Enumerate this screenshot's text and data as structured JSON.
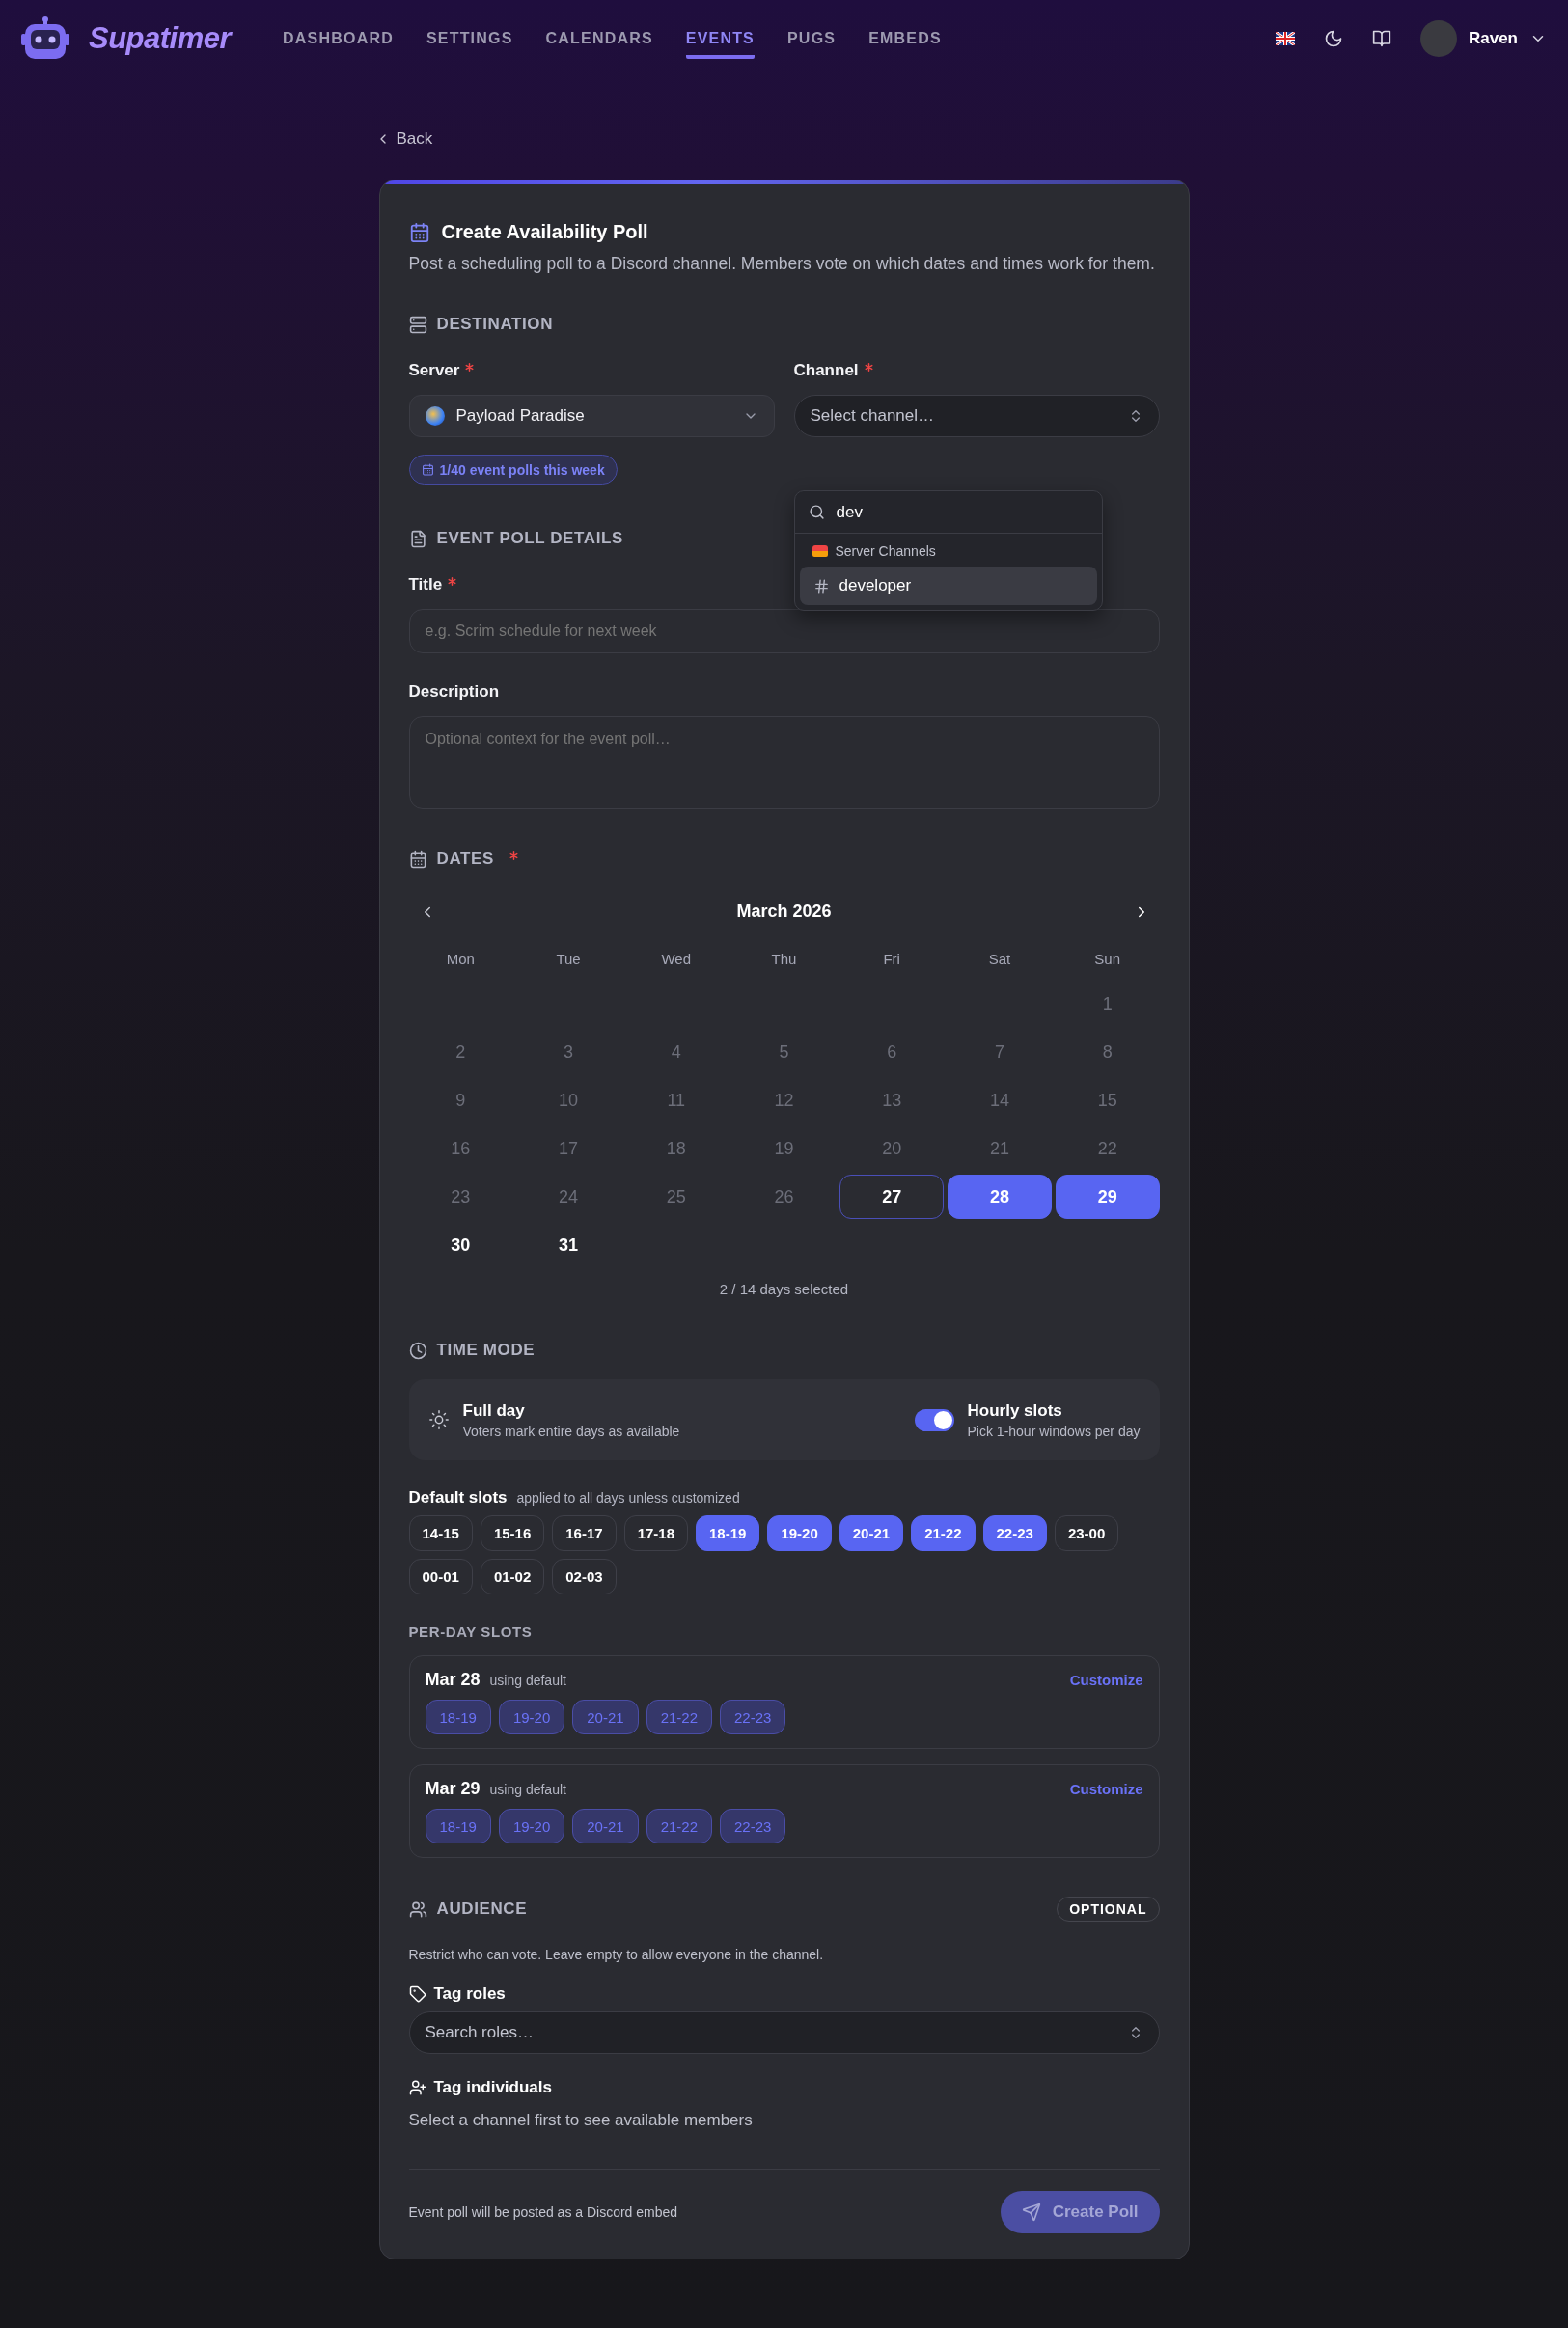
{
  "header": {
    "brand": "Supatimer",
    "nav": [
      {
        "label": "DASHBOARD",
        "selected": false
      },
      {
        "label": "SETTINGS",
        "selected": false
      },
      {
        "label": "CALENDARS",
        "selected": false
      },
      {
        "label": "EVENTS",
        "selected": true
      },
      {
        "label": "PUGS",
        "selected": false
      },
      {
        "label": "EMBEDS",
        "selected": false
      }
    ],
    "user": {
      "name": "Raven"
    }
  },
  "back": {
    "label": "Back"
  },
  "poll": {
    "title": "Create Availability Poll",
    "description": "Post a scheduling poll to a Discord channel. Members vote on which dates and times work for them.",
    "destination": {
      "heading": "DESTINATION",
      "server": {
        "label": "Server",
        "required": true,
        "value": "Payload Paradise"
      },
      "quota": "1/40 event polls this week",
      "channel": {
        "label": "Channel",
        "required": true,
        "placeholder": "Select channel…",
        "dropdown": {
          "query": "dev",
          "group": "Server Channels",
          "options": [
            {
              "label": "developer",
              "selected": true
            }
          ]
        }
      }
    },
    "details": {
      "heading": "EVENT POLL DETAILS",
      "title": {
        "label": "Title",
        "required": true,
        "placeholder": "e.g. Scrim schedule for next week"
      },
      "description": {
        "label": "Description",
        "required": false,
        "placeholder": "Optional context for the event poll…"
      }
    },
    "dates": {
      "heading": "DATES",
      "required": true,
      "month": "March 2026",
      "weekdays": [
        "Mon",
        "Tue",
        "Wed",
        "Thu",
        "Fri",
        "Sat",
        "Sun"
      ],
      "weeks": [
        {
          "days": [
            {
              "label": "1",
              "kind": "past",
              "selected": false
            }
          ]
        },
        {
          "days": [
            {
              "label": "2",
              "kind": "past",
              "selected": false
            },
            {
              "label": "3",
              "kind": "past",
              "selected": false
            },
            {
              "label": "4",
              "kind": "past",
              "selected": false
            },
            {
              "label": "5",
              "kind": "past",
              "selected": false
            },
            {
              "label": "6",
              "kind": "past",
              "selected": false
            },
            {
              "label": "7",
              "kind": "past",
              "selected": false
            },
            {
              "label": "8",
              "kind": "past",
              "selected": false
            }
          ]
        },
        {
          "days": [
            {
              "label": "9",
              "kind": "past",
              "selected": false
            },
            {
              "label": "10",
              "kind": "past",
              "selected": false
            },
            {
              "label": "11",
              "kind": "past",
              "selected": false
            },
            {
              "label": "12",
              "kind": "past",
              "selected": false
            },
            {
              "label": "13",
              "kind": "past",
              "selected": false
            },
            {
              "label": "14",
              "kind": "past",
              "selected": false
            },
            {
              "label": "15",
              "kind": "past",
              "selected": false
            }
          ]
        },
        {
          "days": [
            {
              "label": "16",
              "kind": "past",
              "selected": false
            },
            {
              "label": "17",
              "kind": "past",
              "selected": false
            },
            {
              "label": "18",
              "kind": "past",
              "selected": false
            },
            {
              "label": "19",
              "kind": "past",
              "selected": false
            },
            {
              "label": "20",
              "kind": "past",
              "selected": false
            },
            {
              "label": "21",
              "kind": "past",
              "selected": false
            },
            {
              "label": "22",
              "kind": "past",
              "selected": false
            }
          ]
        },
        {
          "days": [
            {
              "label": "23",
              "kind": "past",
              "selected": false
            },
            {
              "label": "24",
              "kind": "past",
              "selected": false
            },
            {
              "label": "25",
              "kind": "past",
              "selected": false
            },
            {
              "label": "26",
              "kind": "past",
              "selected": false
            },
            {
              "label": "27",
              "kind": "today",
              "selected": false
            },
            {
              "label": "28",
              "kind": "open",
              "selected": true
            },
            {
              "label": "29",
              "kind": "open",
              "selected": true
            }
          ]
        },
        {
          "days": [
            {
              "label": "30",
              "kind": "open",
              "selected": false
            },
            {
              "label": "31",
              "kind": "open",
              "selected": false
            }
          ]
        }
      ],
      "summary": "2 / 14 days selected"
    },
    "time_mode": {
      "heading": "TIME MODE",
      "full_day": {
        "label": "Full day",
        "hint": "Voters mark entire days as available"
      },
      "hourly": {
        "label": "Hourly slots",
        "hint": "Pick 1-hour windows per day",
        "on": true
      }
    },
    "default_slots": {
      "label": "Default slots",
      "hint": "applied to all days unless customized",
      "slots": [
        {
          "label": "14-15",
          "selected": false
        },
        {
          "label": "15-16",
          "selected": false
        },
        {
          "label": "16-17",
          "selected": false
        },
        {
          "label": "17-18",
          "selected": false
        },
        {
          "label": "18-19",
          "selected": true
        },
        {
          "label": "19-20",
          "selected": true
        },
        {
          "label": "20-21",
          "selected": true
        },
        {
          "label": "21-22",
          "selected": true
        },
        {
          "label": "22-23",
          "selected": true
        },
        {
          "label": "23-00",
          "selected": false
        },
        {
          "label": "00-01",
          "selected": false
        },
        {
          "label": "01-02",
          "selected": false
        },
        {
          "label": "02-03",
          "selected": false
        }
      ]
    },
    "per_day": {
      "heading": "PER-DAY SLOTS",
      "days": [
        {
          "date": "Mar 28",
          "note": "using default",
          "action": "Customize",
          "slots": [
            "18-19",
            "19-20",
            "20-21",
            "21-22",
            "22-23"
          ]
        },
        {
          "date": "Mar 29",
          "note": "using default",
          "action": "Customize",
          "slots": [
            "18-19",
            "19-20",
            "20-21",
            "21-22",
            "22-23"
          ]
        }
      ]
    },
    "audience": {
      "heading": "AUDIENCE",
      "badge": "OPTIONAL",
      "hint": "Restrict who can vote. Leave empty to allow everyone in the channel.",
      "tag_roles": {
        "label": "Tag roles",
        "placeholder": "Search roles…"
      },
      "tag_individuals": {
        "label": "Tag individuals",
        "note": "Select a channel first to see available members"
      }
    },
    "footer": {
      "note": "Event poll will be posted as a Discord embed",
      "button": {
        "label": "Create Poll",
        "disabled": true
      }
    }
  }
}
